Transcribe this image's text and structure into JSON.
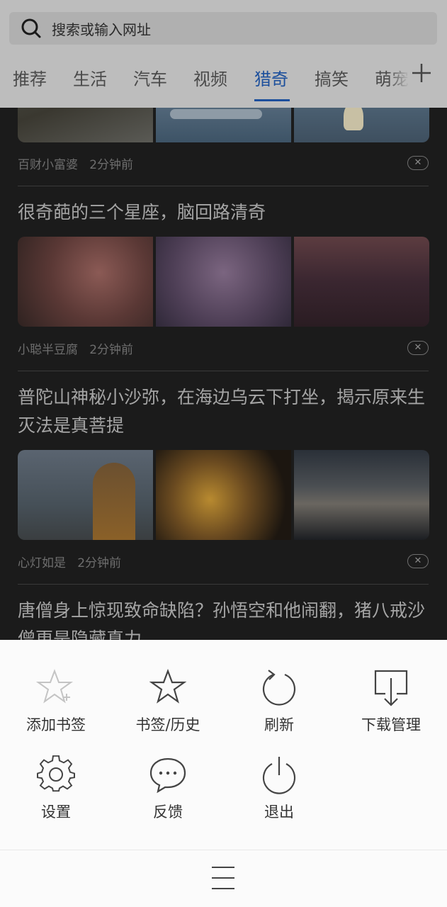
{
  "search": {
    "placeholder": "搜索或输入网址"
  },
  "tabs": [
    "推荐",
    "生活",
    "汽车",
    "视频",
    "猎奇",
    "搞笑",
    "萌宠"
  ],
  "active_tab": "猎奇",
  "articles": [
    {
      "source": "百财小富婆",
      "time": "2分钟前"
    },
    {
      "title": "很奇葩的三个星座，脑回路清奇",
      "source": "小聪半豆腐",
      "time": "2分钟前"
    },
    {
      "title": "普陀山神秘小沙弥，在海边乌云下打坐，揭示原来生灭法是真菩提",
      "source": "心灯如是",
      "time": "2分钟前"
    },
    {
      "title": "唐僧身上惊现致命缺陷？孙悟空和他闹翻，猪八戒沙僧更是隐藏真力"
    }
  ],
  "menu": {
    "add_bookmark": "添加书签",
    "bookmarks_history": "书签/历史",
    "refresh": "刷新",
    "downloads": "下载管理",
    "settings": "设置",
    "feedback": "反馈",
    "exit": "退出"
  },
  "colors": {
    "accent": "#1c4f9c",
    "overlay": "#1b1b1b",
    "sheet": "#fbfbfb"
  }
}
